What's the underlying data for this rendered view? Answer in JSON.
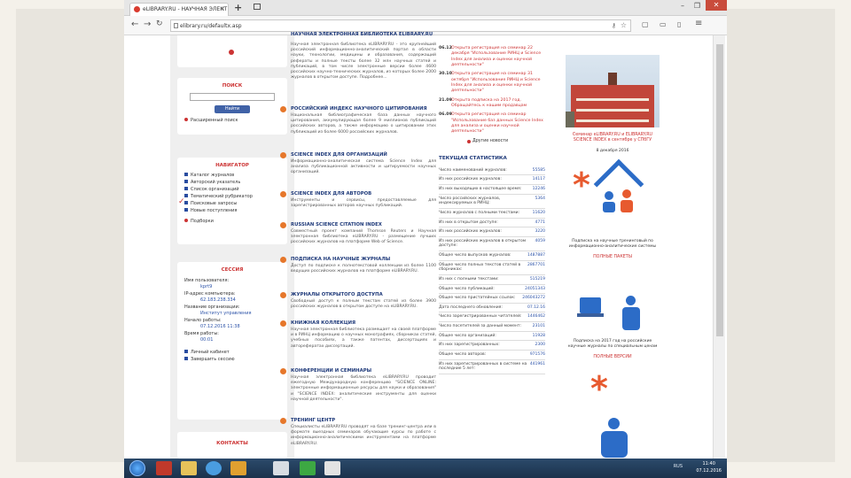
{
  "browser": {
    "tab_title": "eLIBRARY.RU - НАУЧНАЯ ЭЛЕКТ",
    "url": "elibrary.ru/defaultx.asp",
    "close": "✕",
    "minimize": "–",
    "restore": "❐"
  },
  "left": {
    "search_title": "ПОИСК",
    "search_button": "Найти",
    "advanced_search": "Расширенный поиск",
    "navigator_title": "НАВИГАТОР",
    "navigator_items": [
      "Каталог журналов",
      "Авторский указатель",
      "Список организаций",
      "Тематический рубрикатор",
      "Поисковые запросы",
      "Новые поступления"
    ],
    "navigator_extra": "Подборки",
    "session_title": "СЕССИЯ",
    "session_rows": [
      {
        "label": "Имя пользователя:",
        "value": "kprt9"
      },
      {
        "label": "IP-адрес компьютера:",
        "value": "62.183.238.334"
      },
      {
        "label": "Название организации:",
        "value": "Институт управления"
      },
      {
        "label": "Начало работы:",
        "value": "07.12.2016 11:38"
      },
      {
        "label": "Время работы:",
        "value": "00:01"
      }
    ],
    "session_links": [
      "Личный кабинет",
      "Завершить сессию"
    ],
    "contacts_title": "КОНТАКТЫ"
  },
  "main": {
    "sections": [
      {
        "title": "НАУЧНАЯ ЭЛЕКТРОННАЯ БИБЛИОТЕКА ELIBRARY.RU",
        "text": "Научная электронная библиотека eLIBRARY.RU - это крупнейший российский информационно-аналитический портал в области науки, технологии, медицины и образования, содержащий рефераты и полные тексты более 32 млн научных статей и публикаций, в том числе электронные версии более 4600 российских научно-технических журналов, из которых более 2000 журналов в открытом доступе. Подробнее..."
      },
      {
        "title": "РОССИЙСКИЙ ИНДЕКС НАУЧНОГО ЦИТИРОВАНИЯ",
        "text": "Национальная библиографическая база данных научного цитирования, аккумулирующая более 9 миллионов публикаций российских авторов, а также информацию о цитировании этих публикаций из более 6000 российских журналов."
      },
      {
        "title": "SCIENCE INDEX ДЛЯ ОРГАНИЗАЦИЙ",
        "text": "Информационно-аналитическая система Science Index для анализа публикационной активности и цитируемости научных организаций."
      },
      {
        "title": "SCIENCE INDEX ДЛЯ АВТОРОВ",
        "text": "Инструменты и сервисы, предоставляемые для зарегистрированных авторов научных публикаций."
      },
      {
        "title": "RUSSIAN SCIENCE CITATION INDEX",
        "text": "Совместный проект компаний Thomson Reuters и Научная электронная библиотека eLIBRARY.RU - размещение лучших российских журналов на платформе Web of Science."
      },
      {
        "title": "ПОДПИСКА НА НАУЧНЫЕ ЖУРНАЛЫ",
        "text": "Доступ по подписке к полнотекстовой коллекции из более 1100 ведущих российских журналов на платформе eLIBRARY.RU."
      },
      {
        "title": "ЖУРНАЛЫ ОТКРЫТОГО ДОСТУПА",
        "text": "Свободный доступ к полным текстам статей из более 3900 российских журналов в открытом доступе на eLIBRARY.RU."
      },
      {
        "title": "КНИЖНАЯ КОЛЛЕКЦИЯ",
        "text": "Научная электронная библиотека размещает на своей платформе и в РИНЦ информацию о научных монографиях, сборниках статей, учебных пособиях, а также патентах, диссертациях и авторефератах диссертаций."
      },
      {
        "title": "КОНФЕРЕНЦИИ И СЕМИНАРЫ",
        "text": "Научная электронная библиотека eLIBRARY.RU проводит ежегодную Международную конференцию \"SCIENCE ONLINE: электронные информационные ресурсы для науки и образования\" и \"SCIENCE INDEX: аналитические инструменты для оценки научной деятельности\"."
      },
      {
        "title": "ТРЕНИНГ ЦЕНТР",
        "text": "Специалисты eLIBRARY.RU проводят на базе тренинг-центра или в формате выездных семинаров обучающие курсы по работе с информационно-аналитическими инструментами на платформе eLIBRARY.RU."
      }
    ]
  },
  "news": {
    "items": [
      {
        "date": "06.12",
        "text": "Открыта регистрация на семинар 22 декабря \"Использование РИНЦ и Science Index для анализа и оценки научной деятельности\""
      },
      {
        "date": "30.10",
        "text": "Открыта регистрация на семинар 31 октября \"Использование РИНЦ и Science Index для анализа и оценки научной деятельности\""
      },
      {
        "date": "21.09",
        "text": "Открыта подписка на 2017 год. Обращайтесь к нашим продавцам"
      },
      {
        "date": "06.09",
        "text": "Открыта регистрация на семинар \"Использование баз данных Science Index для анализа и оценки научной деятельности\""
      }
    ],
    "all_news": "Другие новости",
    "stats_title": "ТЕКУЩАЯ СТАТИСТИКА",
    "stats": [
      {
        "label": "Число наименований журналов:",
        "value": "55585"
      },
      {
        "label": "Из них российских журналов:",
        "value": "14117"
      },
      {
        "label": "Из них выходящих в настоящее время:",
        "value": "12246"
      },
      {
        "label": "Число российских журналов, индексируемых в РИНЦ:",
        "value": "5364"
      },
      {
        "label": "Число журналов с полными текстами:",
        "value": "11620"
      },
      {
        "label": "Из них в открытом доступе:",
        "value": "4771"
      },
      {
        "label": "Из них российских журналов:",
        "value": "3220"
      },
      {
        "label": "Из них российских журналов в открытом доступе:",
        "value": "4059"
      },
      {
        "label": "Общее число выпусков журналов:",
        "value": "1487887"
      },
      {
        "label": "Общее число полных текстов статей в сборниках:",
        "value": "2867701"
      },
      {
        "label": "Из них с полными текстами:",
        "value": "515219"
      },
      {
        "label": "Общее число публикаций:",
        "value": "24051343"
      },
      {
        "label": "Общее число пристатейных ссылок:",
        "value": "246043272"
      },
      {
        "label": "Дата последнего обновления:",
        "value": "07.12.16"
      },
      {
        "label": "Число зарегистрированных читателей:",
        "value": "1446462"
      },
      {
        "label": "Число посетителей за данный момент:",
        "value": "23101"
      },
      {
        "label": "Общее число организаций:",
        "value": "11928"
      },
      {
        "label": "Из них зарегистрированных:",
        "value": "2300"
      },
      {
        "label": "Общее число авторов:",
        "value": "971576"
      },
      {
        "label": "Из них зарегистрированных в системе на последние 5 лет:",
        "value": "441961"
      }
    ]
  },
  "right": {
    "photo_caption": "Семинар eLIBRARY.RU и ELIBRARY.RU SCIENCE INDEX в сентябре у СПбГУ",
    "photo_date": "8 декабря 2016",
    "promo1": "Подписка на научные тренинговый по информационно-аналитические системы",
    "promo1_link": "ПОЛНЫЕ ПАКЕТЫ",
    "promo2": "Подписка на 2017 год на российские научные журналы по специальным ценам",
    "promo2_link": "ПОЛНЫЕ ВЕРСИИ"
  },
  "taskbar": {
    "lang": "RUS",
    "time": "11:40",
    "date": "07.12.2016"
  },
  "colors": {
    "brand_red": "#c33333",
    "link_blue": "#2b52a8",
    "accent_orange": "#e6772b",
    "heading_navy": "#1f3a7a",
    "promo_blue": "#2c6cc7"
  }
}
